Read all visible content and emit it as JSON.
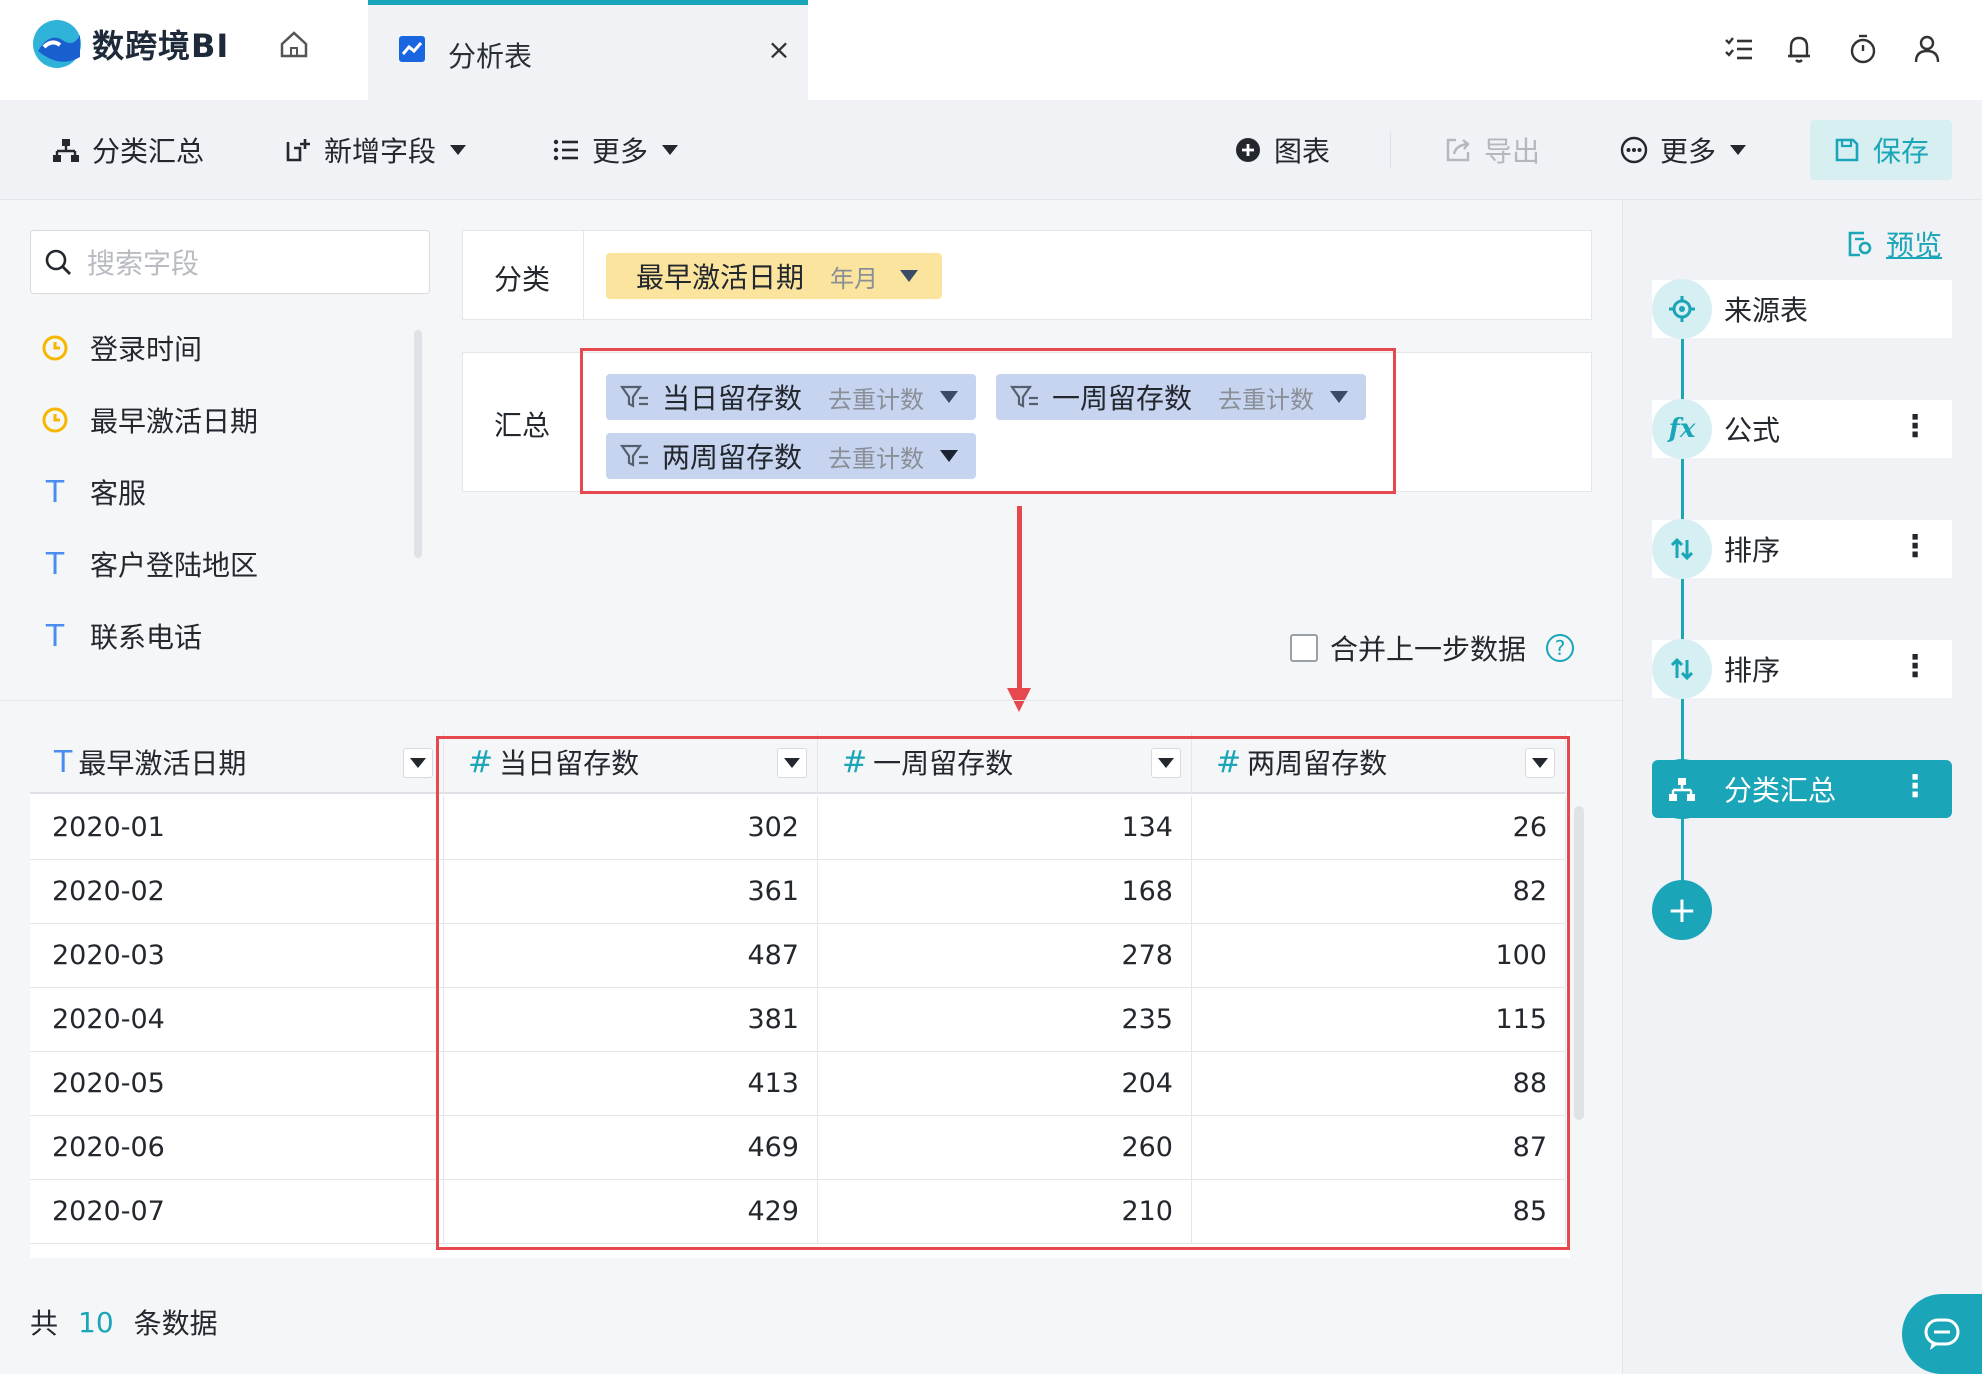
{
  "app": {
    "name": "数跨境BI"
  },
  "tab": {
    "label": "分析表",
    "close": "×"
  },
  "toolbar": {
    "group_summary": "分类汇总",
    "add_field": "新增字段",
    "more_left": "更多",
    "chart": "图表",
    "export": "导出",
    "more_right": "更多",
    "save": "保存"
  },
  "fields": {
    "search_placeholder": "搜索字段",
    "items": [
      {
        "label": "登录时间",
        "type": "clock-icon"
      },
      {
        "label": "最早激活日期",
        "type": "clock-icon"
      },
      {
        "label": "客服",
        "type": "T"
      },
      {
        "label": "客户登陆地区",
        "type": "T"
      },
      {
        "label": "联系电话",
        "type": "T"
      }
    ]
  },
  "config": {
    "category_label": "分类",
    "category_chip": {
      "name": "最早激活日期",
      "sub": "年月"
    },
    "summary_label": "汇总",
    "summary_chips": [
      {
        "name": "当日留存数",
        "sub": "去重计数"
      },
      {
        "name": "一周留存数",
        "sub": "去重计数"
      },
      {
        "name": "两周留存数",
        "sub": "去重计数"
      }
    ],
    "merge_label": "合并上一步数据",
    "help": "?"
  },
  "table": {
    "columns": [
      {
        "type": "T",
        "name": "最早激活日期"
      },
      {
        "type": "#",
        "name": "当日留存数"
      },
      {
        "type": "#",
        "name": "一周留存数"
      },
      {
        "type": "#",
        "name": "两周留存数"
      }
    ],
    "rows": [
      [
        "2020-01",
        "302",
        "134",
        "26"
      ],
      [
        "2020-02",
        "361",
        "168",
        "82"
      ],
      [
        "2020-03",
        "487",
        "278",
        "100"
      ],
      [
        "2020-04",
        "381",
        "235",
        "115"
      ],
      [
        "2020-05",
        "413",
        "204",
        "88"
      ],
      [
        "2020-06",
        "469",
        "260",
        "87"
      ],
      [
        "2020-07",
        "429",
        "210",
        "85"
      ]
    ],
    "footer": {
      "prefix": "共",
      "count": "10",
      "suffix": "条数据"
    }
  },
  "flow": {
    "preview": "预览",
    "steps": [
      {
        "label": "来源表",
        "icon": "source-icon",
        "menu": false
      },
      {
        "label": "公式",
        "icon": "fx-icon",
        "menu": true
      },
      {
        "label": "排序",
        "icon": "sort-icon",
        "menu": true
      },
      {
        "label": "排序",
        "icon": "sort-icon",
        "menu": true
      },
      {
        "label": "分类汇总",
        "icon": "group-summary-icon",
        "menu": true,
        "active": true
      }
    ],
    "add": "+",
    "menu_glyph": "⋮"
  },
  "colors": {
    "accent": "#1aa5b8",
    "highlight": "#e5484d",
    "chip_blue": "#c6d4f0",
    "chip_yellow": "#fbe59e"
  }
}
